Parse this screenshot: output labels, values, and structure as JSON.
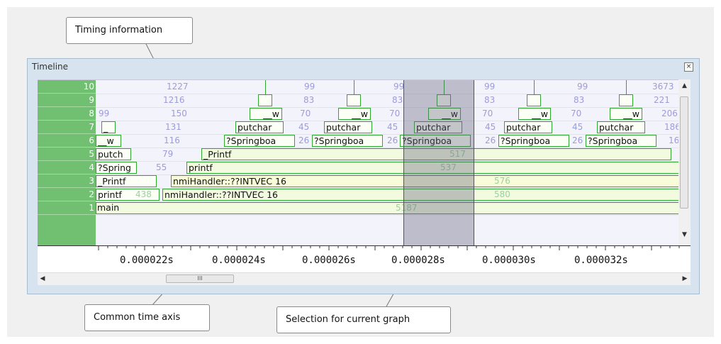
{
  "callouts": {
    "timing": "Timing information",
    "axis": "Common time axis",
    "selection": "Selection for current graph"
  },
  "panel": {
    "title": "Timeline",
    "close_icon": "close-icon",
    "row_numbers": [
      "10",
      "9",
      "8",
      "7",
      "6",
      "5",
      "4",
      "3",
      "2",
      "1"
    ]
  },
  "timing": {
    "r10": [
      "1227",
      "99",
      "99",
      "99",
      "99",
      "3673"
    ],
    "r9": [
      "1216",
      "83",
      "83",
      "83",
      "83",
      "221"
    ],
    "r8": [
      "99",
      "150",
      "70",
      "70",
      "70",
      "70",
      "206"
    ],
    "r7": [
      "131",
      "45",
      "45",
      "45",
      "45",
      "186"
    ],
    "r6": [
      "116",
      "26",
      "26",
      "26",
      "26",
      "16"
    ],
    "r5": [
      "79",
      "517"
    ],
    "r4": [
      "55",
      "537"
    ],
    "r3": [
      "576"
    ],
    "r2": [
      "438",
      "580"
    ],
    "r1": [
      "5187"
    ]
  },
  "calls": {
    "r8_w": "__w",
    "r7_left": "_",
    "r7_putchar": "putchar",
    "r6_left": "__w",
    "r6_spring": "?Springboa",
    "r5_left": "putch",
    "r5_printf": "_Printf",
    "r4_left": "?Spring",
    "r4_printf": "printf",
    "r3_left": "_Printf",
    "r3_nmi": "nmiHandler::??INTVEC 16",
    "r2_left": "printf",
    "r2_nmi": "nmiHandler::??INTVEC 16",
    "r1_main": "main"
  },
  "axis": {
    "ticks": [
      "0.000022s",
      "0.000024s",
      "0.000026s",
      "0.000028s",
      "0.000030s",
      "0.000032s"
    ]
  },
  "scroll": {
    "grip": "III"
  },
  "icons": {
    "up": "scroll-up-icon",
    "down": "scroll-down-icon",
    "left": "scroll-left-icon",
    "right": "scroll-right-icon"
  },
  "colors": {
    "row_number_bg": "#71bf71",
    "box_border": "#2ea82e",
    "timing_text": "#9c9cd8",
    "selection": "#5f5f78",
    "panel_bg": "#d7e3ee"
  }
}
